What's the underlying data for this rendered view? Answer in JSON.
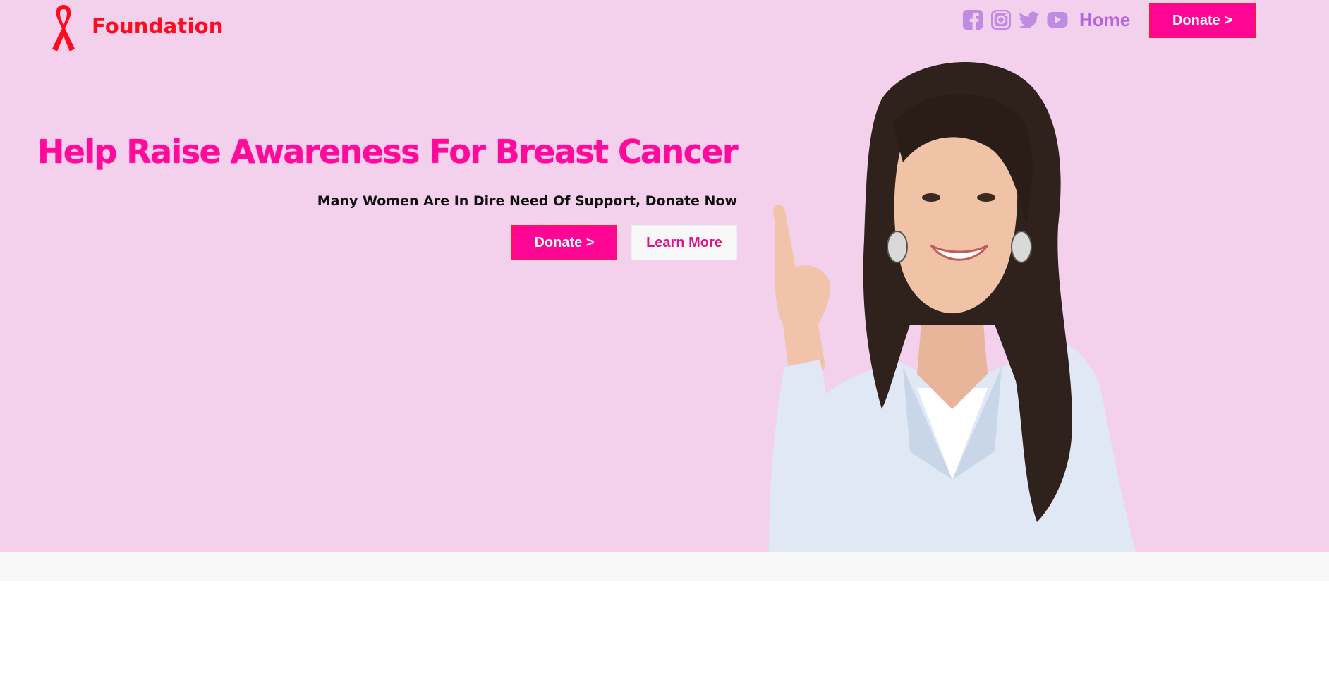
{
  "header": {
    "brand": "Foundation",
    "logo_icon": "awareness-ribbon-icon",
    "socials": [
      {
        "name": "facebook-icon",
        "color": "#c08be3"
      },
      {
        "name": "instagram-icon",
        "color": "#c08be3"
      },
      {
        "name": "twitter-icon",
        "color": "#c08be3"
      },
      {
        "name": "youtube-icon",
        "color": "#c08be3"
      }
    ],
    "nav_home": "Home",
    "nav_donate": "Donate >"
  },
  "hero": {
    "headline": "Help Raise Awareness For Breast Cancer",
    "subline": "Many Women Are In Dire Need Of Support, Donate Now",
    "donate_button": "Donate >",
    "learn_more_button": "Learn More",
    "image": "smiling-woman-pointing-up"
  },
  "colors": {
    "hero_background": "#f3d0ec",
    "accent_pink": "#ff0596",
    "brand_red": "#ff0a1f",
    "nav_purple": "#b565de"
  }
}
